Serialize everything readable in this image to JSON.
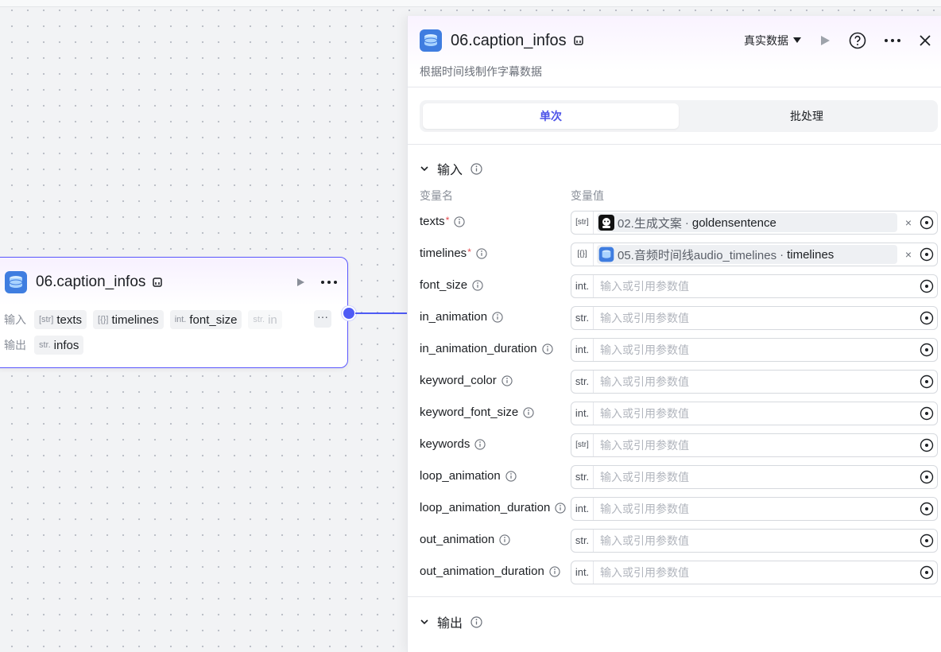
{
  "node": {
    "title": "06.caption_infos",
    "input_label": "输入",
    "output_label": "输出",
    "inputs": [
      {
        "type": "[str]",
        "name": "texts"
      },
      {
        "type": "[{}]",
        "name": "timelines"
      },
      {
        "type": "int.",
        "name": "font_size"
      },
      {
        "type": "str.",
        "name": "in"
      }
    ],
    "more": "···",
    "outputs": [
      {
        "type": "str.",
        "name": "infos"
      }
    ]
  },
  "panel": {
    "title": "06.caption_infos",
    "description": "根据时间线制作字幕数据",
    "data_mode": "真实数据",
    "tabs": [
      {
        "label": "单次",
        "active": true
      },
      {
        "label": "批处理",
        "active": false
      }
    ],
    "input_section": "输入",
    "output_section": "输出",
    "col_name": "变量名",
    "col_value": "变量值",
    "placeholder": "输入或引用参数值",
    "params": [
      {
        "name": "texts",
        "required": true,
        "type": "[str]",
        "ref": {
          "source": "02.生成文案",
          "field": "goldensentence",
          "icon": "bot"
        }
      },
      {
        "name": "timelines",
        "required": true,
        "type": "[{}]",
        "ref": {
          "source": "05.音频时间线audio_timelines",
          "field": "timelines",
          "icon": "db"
        }
      },
      {
        "name": "font_size",
        "required": false,
        "type": "int."
      },
      {
        "name": "in_animation",
        "required": false,
        "type": "str."
      },
      {
        "name": "in_animation_duration",
        "required": false,
        "type": "int."
      },
      {
        "name": "keyword_color",
        "required": false,
        "type": "str."
      },
      {
        "name": "keyword_font_size",
        "required": false,
        "type": "int."
      },
      {
        "name": "keywords",
        "required": false,
        "type": "[str]"
      },
      {
        "name": "loop_animation",
        "required": false,
        "type": "str."
      },
      {
        "name": "loop_animation_duration",
        "required": false,
        "type": "int."
      },
      {
        "name": "out_animation",
        "required": false,
        "type": "str."
      },
      {
        "name": "out_animation_duration",
        "required": false,
        "type": "int."
      }
    ]
  },
  "colors": {
    "accent": "#4d53e8",
    "required": "#e5484d",
    "node_border": "#5a57ff"
  }
}
